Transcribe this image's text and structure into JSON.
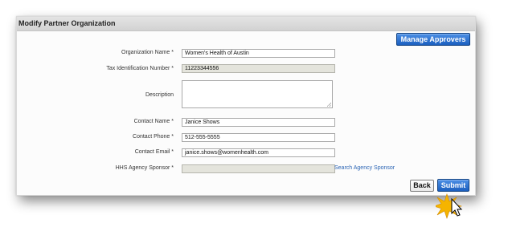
{
  "dialog": {
    "title": "Modify Partner Organization",
    "manage_approvers_label": "Manage Approvers",
    "back_label": "Back",
    "submit_label": "Submit"
  },
  "form": {
    "organization_name": {
      "label": "Organization Name *",
      "value": "Women's Health of Austin"
    },
    "tax_id": {
      "label": "Tax Identification Number *",
      "value": "11223344556"
    },
    "description": {
      "label": "Description",
      "value": ""
    },
    "contact_name": {
      "label": "Contact Name *",
      "value": "Janice Shows"
    },
    "contact_phone": {
      "label": "Contact Phone *",
      "value": "512-555-5555"
    },
    "contact_email": {
      "label": "Contact Email *",
      "value": "janice.shows@womenhealth.com"
    },
    "hhs_agency_sponsor": {
      "label": "HHS Agency Sponsor *",
      "value": "",
      "link_label": "Search Agency Sponsor"
    }
  },
  "colors": {
    "primary_button": "#1b5fbf",
    "link": "#2a64b4",
    "disabled_field": "#e4e4dc",
    "highlight_burst": "#f5b400"
  }
}
